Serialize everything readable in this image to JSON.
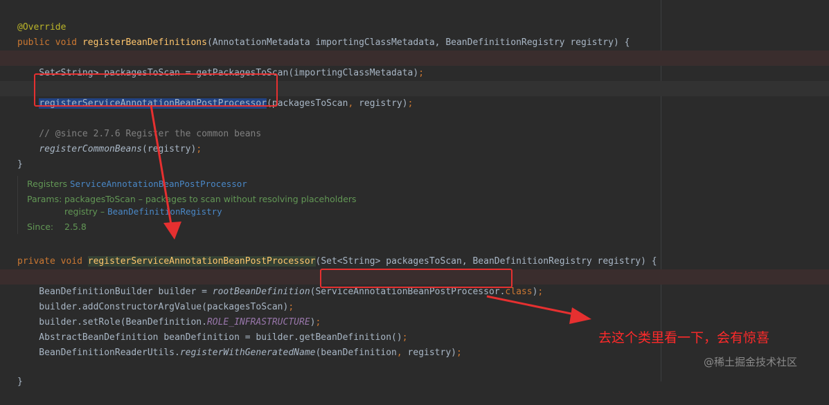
{
  "code": {
    "l1_annotation": "@Override",
    "l2_public": "public ",
    "l2_void": "void ",
    "l2_method": "registerBeanDefinitions",
    "l2_params": "(AnnotationMetadata importingClassMetadata, BeanDefinitionRegistry registry) {",
    "l3_decl": "    Set<String> packagesToScan = getPackagesToScan(importingClassMetadata)",
    "l3_semi": ";",
    "l4_indent": "    ",
    "l4_call": "registerServiceAnnotationBeanPostProcessor",
    "l4_args_a": "(packagesToScan",
    "l4_comma": ", ",
    "l4_args_b": "registry)",
    "l4_semi": ";",
    "l5_comment": "    // @since 2.7.6 Register the common beans",
    "l6_indent": "    ",
    "l6_call": "registerCommonBeans",
    "l6_args": "(registry)",
    "l6_semi": ";",
    "l7_brace": "}",
    "l8_private": "private ",
    "l8_void": "void ",
    "l8_method": "registerServiceAnnotationBeanPostProcessor",
    "l8_params": "(Set<String> packagesToScan, BeanDefinitionRegistry registry) {",
    "l9_start": "    BeanDefinitionBuilder builder = ",
    "l9_call": "rootBeanDefinition",
    "l9_open": "(",
    "l9_class": "ServiceAnnotationBeanPostProcessor",
    "l9_dot": ".",
    "l9_kwclass": "class",
    "l9_end": ")",
    "l9_semi": ";",
    "l10_text": "    builder.addConstructorArgValue(packagesToScan)",
    "l10_semi": ";",
    "l11_start": "    builder.setRole(BeanDefinition.",
    "l11_const": "ROLE_INFRASTRUCTURE",
    "l11_end": ")",
    "l11_semi": ";",
    "l12_text": "    AbstractBeanDefinition beanDefinition = builder.getBeanDefinition()",
    "l12_semi": ";",
    "l13_start": "    BeanDefinitionReaderUtils.",
    "l13_call": "registerWithGeneratedName",
    "l13_args_a": "(beanDefinition",
    "l13_comma": ", ",
    "l13_args_b": "registry)",
    "l13_semi": ";",
    "l14_brace": "}"
  },
  "javadoc": {
    "registers_label": "Registers ",
    "registers_link": "ServiceAnnotationBeanPostProcessor",
    "params_label": "Params:",
    "param1": "packagesToScan – packages to scan without resolving placeholders",
    "param2_name": "registry – ",
    "param2_link": "BeanDefinitionRegistry",
    "since_label": "Since:",
    "since_value": "2.5.8"
  },
  "annotation_note": "去这个类里看一下，会有惊喜",
  "watermark": "@稀土掘金技术社区",
  "colors": {
    "background": "#2b2b2b",
    "keyword": "#cc7832",
    "method": "#ffc66d",
    "highlight_box": "#e63030"
  }
}
